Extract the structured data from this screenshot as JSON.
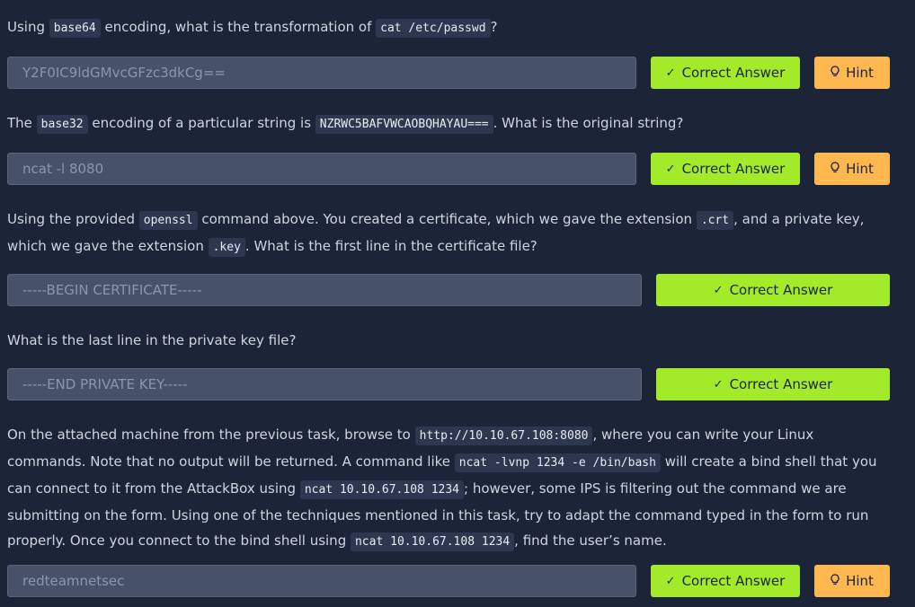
{
  "buttons": {
    "correct_label": "Correct Answer",
    "hint_label": "Hint"
  },
  "icons": {
    "check": "check-icon",
    "hint": "lightbulb-icon"
  },
  "colors": {
    "background": "#1c2538",
    "answer_field": "#47526a",
    "correct_button": "#a3ea2a",
    "hint_button": "#ffb84f",
    "code_background": "#2d3850"
  },
  "questions": [
    {
      "parts": [
        "Using ",
        "base64",
        " encoding, what is the transformation of ",
        "cat /etc/passwd",
        "?"
      ],
      "answer": "Y2F0IC9ldGMvcGFzc3dkCg=="
    },
    {
      "parts": [
        "The ",
        "base32",
        " encoding of a particular string is ",
        "NZRWC5BAFVWCAOBQHAYAU===",
        ". What is the original string?"
      ],
      "answer": "ncat -l 8080"
    },
    {
      "parts": [
        "Using the provided ",
        "openssl",
        " command above. You created a certificate, which we gave the extension ",
        ".crt",
        ", and a private key, which we gave the extension ",
        ".key",
        ". What is the first line in the certificate file?"
      ],
      "answer": "-----BEGIN CERTIFICATE-----"
    },
    {
      "parts": [
        "What is the last line in the private key file?"
      ],
      "answer": "-----END PRIVATE KEY-----"
    },
    {
      "parts": [
        "On the attached machine from the previous task, browse to ",
        "http://10.10.67.108:8080",
        ", where you can write your Linux commands. Note that no output will be returned. A command like ",
        "ncat -lvnp 1234 -e /bin/bash",
        " will create a bind shell that you can connect to it from the AttackBox using ",
        "ncat 10.10.67.108 1234",
        "; however, some IPS is filtering out the command we are submitting on the form. Using one of the techniques mentioned in this task, try to adapt the command typed in the form to run properly. Once you connect to the bind shell using ",
        "ncat 10.10.67.108 1234",
        ", find the user’s name."
      ],
      "answer": "redteamnetsec"
    }
  ]
}
